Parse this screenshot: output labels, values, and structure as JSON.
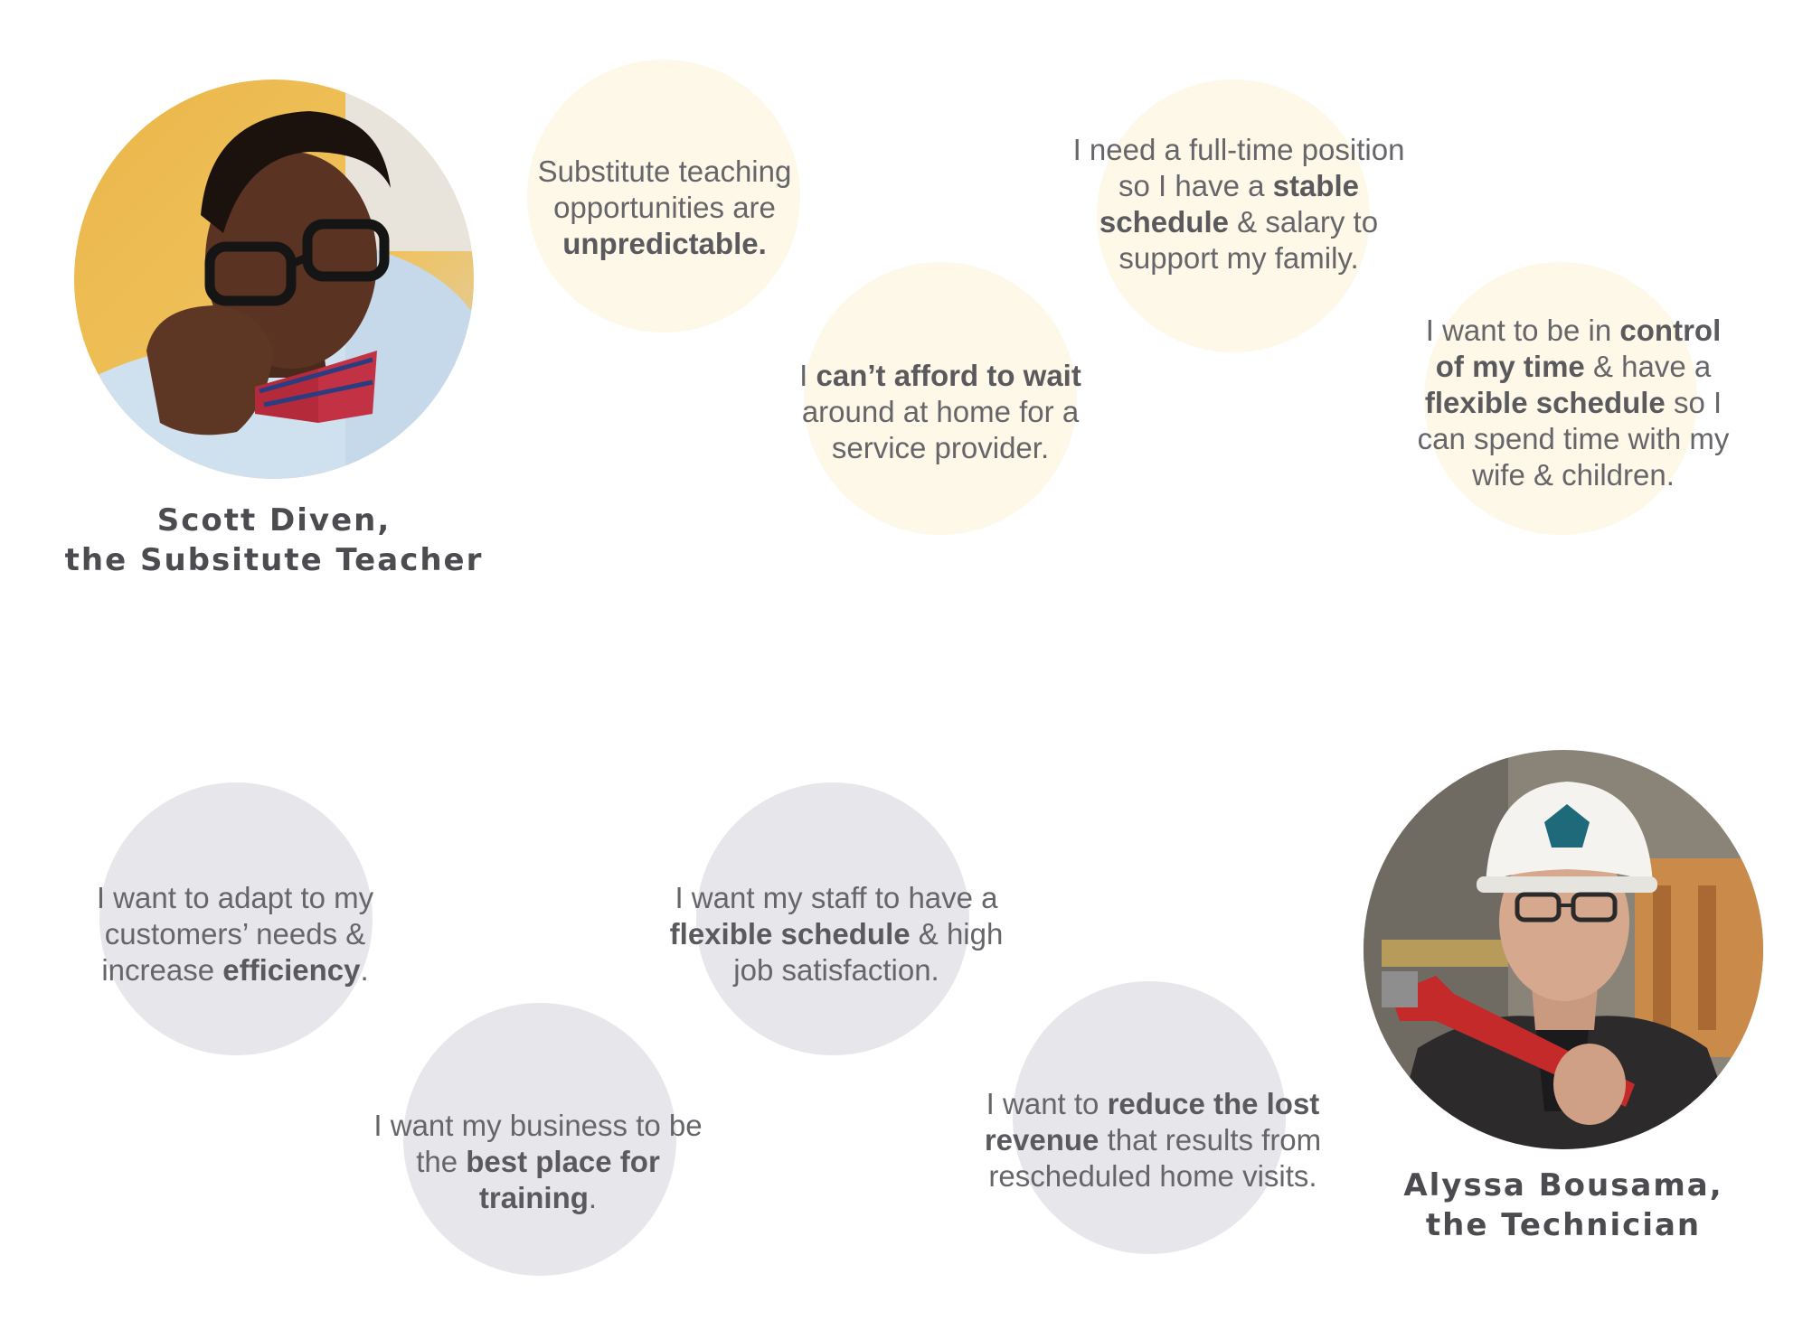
{
  "personas": {
    "teacher": {
      "name": "Scott Diven,",
      "role": "the Subsitute Teacher",
      "photo_icon": "teacher-portrait",
      "bubble_color": "#fdf8e8",
      "quotes": {
        "q1": {
          "a": "Substitute teaching",
          "b": "opportunities are",
          "c": "unpredictable."
        },
        "q2": {
          "a": "I ",
          "b": "can’t afford to wait",
          "c": "around at home for a",
          "d": "service provider."
        },
        "q3": {
          "a": "I need a full-time position",
          "b": "so I have a ",
          "c": "stable",
          "d": "schedule",
          "e": " & salary to",
          "f": "support my family."
        },
        "q4": {
          "a": "I want to be in ",
          "b": "control",
          "c": "of my time",
          "d": " & have a",
          "e": "flexible schedule",
          "f": " so I",
          "g": "can spend time with my",
          "h": "wife & children."
        }
      }
    },
    "technician": {
      "name": "Alyssa Bousama,",
      "role": "the Technician",
      "photo_icon": "technician-portrait",
      "bubble_color": "#e7e6ea",
      "quotes": {
        "q1": {
          "a": "I want to adapt to my",
          "b": "customers’ needs &",
          "c": "increase ",
          "d": "efficiency",
          "e": "."
        },
        "q2": {
          "a": "I want my business to be",
          "b": "the ",
          "c": "best place for training",
          "d": "."
        },
        "q3": {
          "a": "I want my staff to have a",
          "b": "flexible schedule",
          "c": " & high",
          "d": "job satisfaction."
        },
        "q4": {
          "a": "I want to ",
          "b": "reduce the lost",
          "c": "revenue",
          "d": " that results from",
          "e": "rescheduled home visits."
        }
      }
    }
  }
}
